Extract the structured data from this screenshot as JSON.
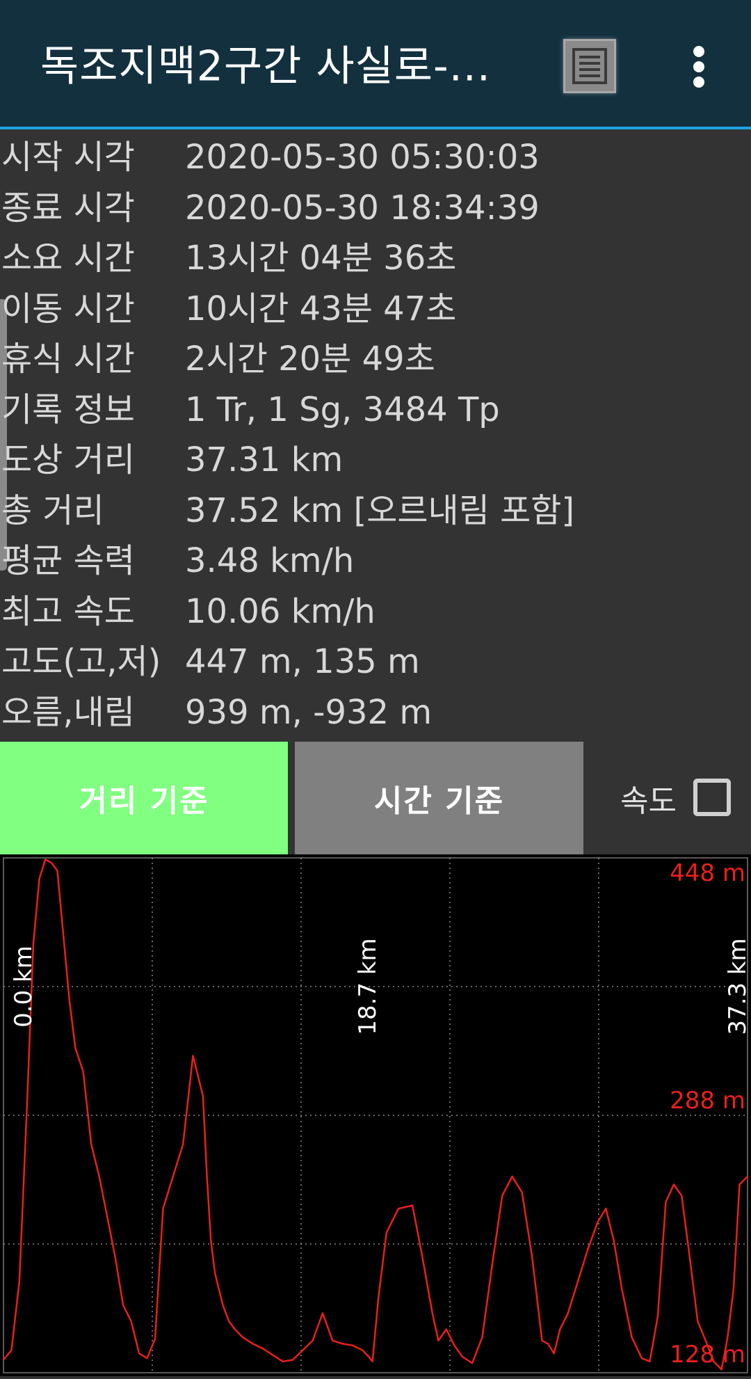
{
  "appbar": {
    "title": "독조지맥2구간 사실로-...",
    "list_icon": "list-icon",
    "menu_icon": "more-vert-icon"
  },
  "info": [
    {
      "label": "시작 시각",
      "value": "2020-05-30 05:30:03"
    },
    {
      "label": "종료 시각",
      "value": "2020-05-30 18:34:39"
    },
    {
      "label": "소요 시간",
      "value": "13시간 04분 36초"
    },
    {
      "label": "이동 시간",
      "value": "10시간 43분 47초"
    },
    {
      "label": "휴식 시간",
      "value": "2시간 20분 49초"
    },
    {
      "label": "기록 정보",
      "value": "1 Tr, 1 Sg, 3484 Tp"
    },
    {
      "label": "도상 거리",
      "value": "37.31 km"
    },
    {
      "label": "총 거리",
      "value": "37.52 km [오르내림 포함]"
    },
    {
      "label": "평균 속력",
      "value": "3.48 km/h"
    },
    {
      "label": "최고 속도",
      "value": "10.06 km/h"
    },
    {
      "label": "고도(고,저)",
      "value": "447 m, 135 m"
    },
    {
      "label": "오름,내림",
      "value": "939 m, -932 m"
    }
  ],
  "controls": {
    "distance_button": "거리 기준",
    "time_button": "시간 기준",
    "speed_label": "속도",
    "speed_checked": false
  },
  "colors": {
    "appbar": "#13303f",
    "accent_line": "#1ea2e0",
    "distance_active": "#80ff80",
    "time_inactive": "#808080",
    "elevation_line": "#e8201e"
  },
  "chart_data": {
    "type": "line",
    "x_tick_labels": [
      "0.0 km",
      "18.7 km",
      "37.3 km"
    ],
    "y_tick_labels": [
      "448 m",
      "288 m",
      "128 m"
    ],
    "xlim": [
      0,
      37.3
    ],
    "ylim": [
      128,
      448
    ],
    "grid": true,
    "series": [
      {
        "x": [
          0,
          0.4,
          0.8,
          1.2,
          1.5,
          1.8,
          2.1,
          2.4,
          2.7,
          3.0,
          3.3,
          3.6,
          4.0,
          4.4,
          4.8,
          5.2,
          5.6,
          6.0,
          6.4,
          6.8,
          7.2,
          7.6,
          8.0,
          8.5,
          9.0,
          9.5,
          10.0,
          10.2,
          10.4,
          10.6,
          10.8,
          11.0,
          11.3,
          11.6,
          12.0,
          12.5,
          13.0,
          13.5,
          14.0,
          14.5,
          15.0,
          15.5,
          16.0,
          16.5,
          17.0,
          17.5,
          18.0,
          18.3,
          18.5,
          18.8,
          19.2,
          19.8,
          20.5,
          21.0,
          21.5,
          21.8,
          22.2,
          22.6,
          23.0,
          23.5,
          24.0,
          24.5,
          25.0,
          25.5,
          26.0,
          26.5,
          27.0,
          27.3,
          27.6,
          27.9,
          28.3,
          28.8,
          29.3,
          29.8,
          30.2,
          30.6,
          31.0,
          31.5,
          32.0,
          32.4,
          32.8,
          33.2,
          33.6,
          34.0,
          34.4,
          34.8,
          35.2,
          35.6,
          36.0,
          36.3,
          36.6,
          36.9,
          37.3
        ],
        "y": [
          136,
          142,
          185,
          300,
          395,
          435,
          447,
          445,
          440,
          400,
          360,
          330,
          315,
          270,
          250,
          225,
          200,
          170,
          160,
          140,
          137,
          149,
          230,
          250,
          270,
          325,
          300,
          250,
          210,
          190,
          180,
          170,
          160,
          155,
          150,
          146,
          143,
          139,
          135,
          136,
          142,
          148,
          165,
          148,
          146,
          145,
          142,
          138,
          135,
          175,
          215,
          230,
          232,
          200,
          165,
          148,
          155,
          145,
          138,
          134,
          150,
          195,
          238,
          250,
          240,
          200,
          148,
          146,
          140,
          155,
          165,
          185,
          205,
          222,
          230,
          210,
          180,
          150,
          137,
          135,
          163,
          234,
          245,
          238,
          200,
          160,
          148,
          135,
          130,
          150,
          180,
          245,
          250
        ]
      }
    ]
  }
}
